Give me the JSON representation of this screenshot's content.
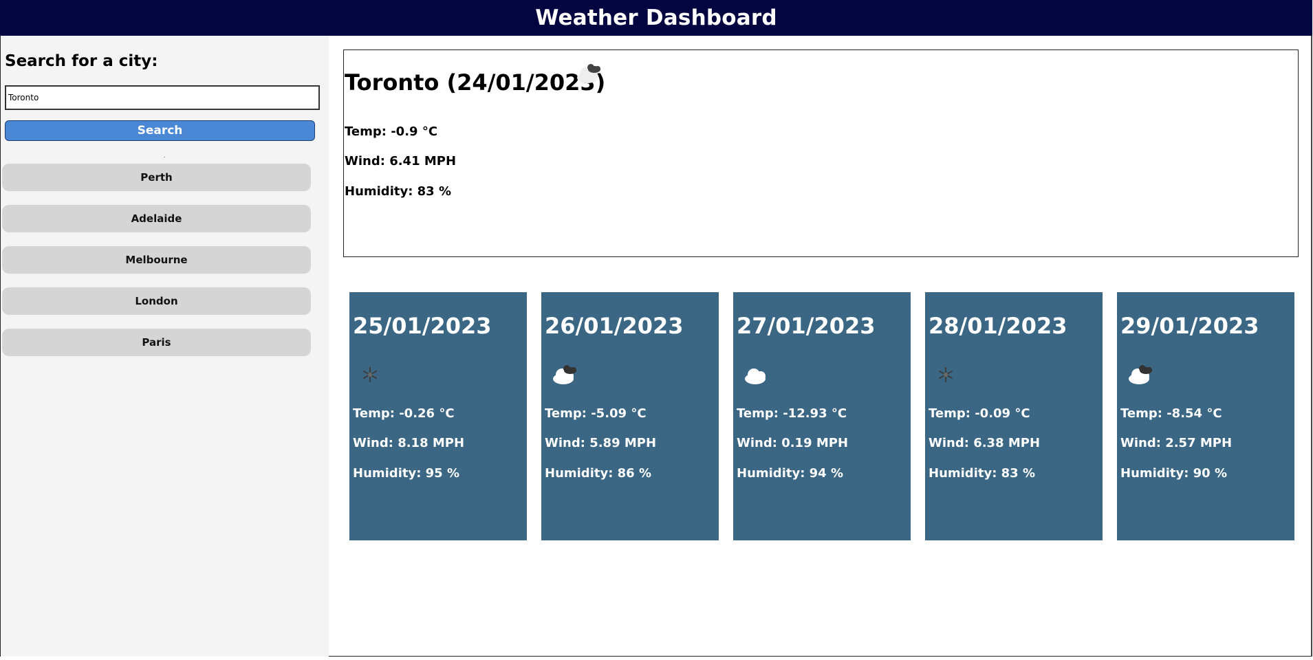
{
  "header": {
    "title": "Weather Dashboard"
  },
  "search": {
    "title": "Search for a city:",
    "value": "Toronto",
    "button_label": "Search"
  },
  "history": [
    {
      "label": "Perth"
    },
    {
      "label": "Adelaide"
    },
    {
      "label": "Melbourne"
    },
    {
      "label": "London"
    },
    {
      "label": "Paris"
    }
  ],
  "current": {
    "title": "Toronto (24/01/2023)",
    "icon": "cloud-dark-icon",
    "temp": "Temp: -0.9 °C",
    "wind": "Wind: 6.41 MPH",
    "humidity": "Humidity: 83 %"
  },
  "forecast": [
    {
      "date": "25/01/2023",
      "icon": "snowflake-icon",
      "temp": "Temp: -0.26 °C",
      "wind": "Wind: 8.18 MPH",
      "humidity": "Humidity: 95 %"
    },
    {
      "date": "26/01/2023",
      "icon": "cloud-dark-icon",
      "temp": "Temp: -5.09 °C",
      "wind": "Wind: 5.89 MPH",
      "humidity": "Humidity: 86 %"
    },
    {
      "date": "27/01/2023",
      "icon": "cloud-icon",
      "temp": "Temp: -12.93 °C",
      "wind": "Wind: 0.19 MPH",
      "humidity": "Humidity: 94 %"
    },
    {
      "date": "28/01/2023",
      "icon": "snowflake-icon",
      "temp": "Temp: -0.09 °C",
      "wind": "Wind: 6.38 MPH",
      "humidity": "Humidity: 83 %"
    },
    {
      "date": "29/01/2023",
      "icon": "cloud-dark-icon",
      "temp": "Temp: -8.54 °C",
      "wind": "Wind: 2.57 MPH",
      "humidity": "Humidity: 90 %"
    }
  ],
  "colors": {
    "header_bg": "#030541",
    "card_bg": "#3b6785",
    "button_bg": "#4a88d6",
    "history_bg": "#d5d5d5"
  }
}
